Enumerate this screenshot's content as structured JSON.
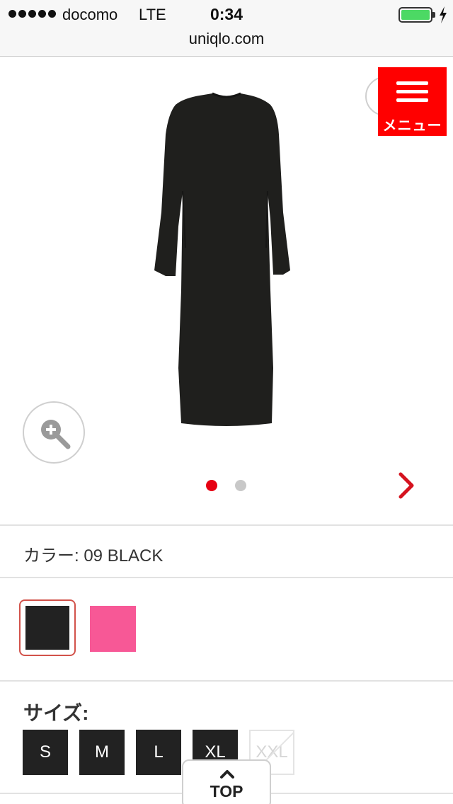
{
  "status_bar": {
    "carrier": "docomo",
    "network": "LTE",
    "time": "0:34",
    "battery_level": 1.0
  },
  "browser": {
    "url": "uniqlo.com"
  },
  "menu": {
    "label": "メニュー",
    "icon": "hamburger-icon",
    "color": "#ff0000"
  },
  "gallery": {
    "image_count": 2,
    "current_index": 1,
    "active_dot_color": "#e60012"
  },
  "product": {
    "color_label": "カラー: 09 BLACK",
    "swatches": [
      {
        "name": "BLACK",
        "hex": "#222222",
        "selected": true
      },
      {
        "name": "PINK",
        "hex": "#f75896",
        "selected": false
      }
    ],
    "size_label": "サイズ:",
    "sizes": [
      {
        "label": "S",
        "available": true
      },
      {
        "label": "M",
        "available": true
      },
      {
        "label": "L",
        "available": true
      },
      {
        "label": "XL",
        "available": true
      },
      {
        "label": "XXL",
        "available": false
      }
    ]
  },
  "top_button": {
    "label": "TOP",
    "icon": "chevron-up-icon"
  }
}
